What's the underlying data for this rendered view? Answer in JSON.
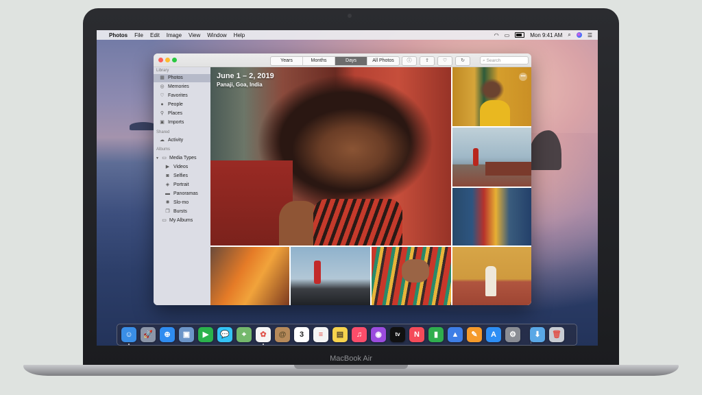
{
  "device": {
    "label": "MacBook Air"
  },
  "menubar": {
    "apple_glyph": "",
    "app_name": "Photos",
    "items": [
      "File",
      "Edit",
      "Image",
      "View",
      "Window",
      "Help"
    ],
    "clock": "Mon 9:41 AM"
  },
  "window": {
    "view_tabs": [
      {
        "label": "Years",
        "active": false
      },
      {
        "label": "Months",
        "active": false
      },
      {
        "label": "Days",
        "active": true
      },
      {
        "label": "All Photos",
        "active": false
      }
    ],
    "toolbar_icons": [
      "info-icon",
      "share-icon",
      "favorite-icon",
      "rotate-icon"
    ],
    "search_placeholder": "Search"
  },
  "sidebar": {
    "library_header": "Library",
    "library": [
      {
        "label": "Photos",
        "icon": "photos-icon",
        "selected": true
      },
      {
        "label": "Memories",
        "icon": "memories-icon"
      },
      {
        "label": "Favorites",
        "icon": "heart-icon"
      },
      {
        "label": "People",
        "icon": "people-icon"
      },
      {
        "label": "Places",
        "icon": "pin-icon"
      },
      {
        "label": "Imports",
        "icon": "imports-icon"
      }
    ],
    "shared_header": "Shared",
    "shared": [
      {
        "label": "Activity",
        "icon": "cloud-icon"
      }
    ],
    "albums_header": "Albums",
    "albums": [
      {
        "label": "Media Types",
        "icon": "folder-icon"
      },
      {
        "label": "Videos",
        "icon": "video-icon"
      },
      {
        "label": "Selfies",
        "icon": "selfie-icon"
      },
      {
        "label": "Portrait",
        "icon": "cube-icon"
      },
      {
        "label": "Panoramas",
        "icon": "panorama-icon"
      },
      {
        "label": "Slo-mo",
        "icon": "slomo-icon"
      },
      {
        "label": "Bursts",
        "icon": "bursts-icon"
      },
      {
        "label": "My Albums",
        "icon": "folder-icon"
      }
    ]
  },
  "moment": {
    "date_range": "June 1 – 2, 2019",
    "location": "Panaji, Goa, India"
  },
  "dock": {
    "apps": [
      {
        "name": "Finder",
        "color": "#3a8ee6",
        "glyph": "☺"
      },
      {
        "name": "Launchpad",
        "color": "#8c96a8",
        "glyph": "🚀"
      },
      {
        "name": "Safari",
        "color": "#2f8cf0",
        "glyph": "⊕"
      },
      {
        "name": "Preview",
        "color": "#6c95c8",
        "glyph": "▣"
      },
      {
        "name": "FaceTime",
        "color": "#2bb24c",
        "glyph": "▶"
      },
      {
        "name": "Messages",
        "color": "#34c3f4",
        "glyph": "💬"
      },
      {
        "name": "Maps",
        "color": "#74b86c",
        "glyph": "⌖"
      },
      {
        "name": "Photos",
        "color": "#f5f5f5",
        "glyph": "✿"
      },
      {
        "name": "Contacts",
        "color": "#b78a5a",
        "glyph": "@"
      },
      {
        "name": "Calendar",
        "color": "#ffffff",
        "glyph": "3"
      },
      {
        "name": "Reminders",
        "color": "#f4f4f4",
        "glyph": "≡"
      },
      {
        "name": "Notes",
        "color": "#f7d34d",
        "glyph": "▤"
      },
      {
        "name": "Music",
        "color": "#fb4d6a",
        "glyph": "♫"
      },
      {
        "name": "Podcasts",
        "color": "#9b4cde",
        "glyph": "◉"
      },
      {
        "name": "TV",
        "color": "#111111",
        "glyph": "tv"
      },
      {
        "name": "News",
        "color": "#f44b59",
        "glyph": "N"
      },
      {
        "name": "Numbers",
        "color": "#2fae4e",
        "glyph": "▮"
      },
      {
        "name": "Keynote",
        "color": "#3e7ee6",
        "glyph": "▲"
      },
      {
        "name": "Pages",
        "color": "#f59a2a",
        "glyph": "✎"
      },
      {
        "name": "App Store",
        "color": "#2d8ef4",
        "glyph": "A"
      },
      {
        "name": "System Preferences",
        "color": "#8a8d94",
        "glyph": "⚙"
      },
      {
        "name": "Downloads",
        "color": "#5aa8e6",
        "glyph": "⬇"
      },
      {
        "name": "Trash",
        "color": "#c8ccd2",
        "glyph": "🗑"
      }
    ]
  }
}
